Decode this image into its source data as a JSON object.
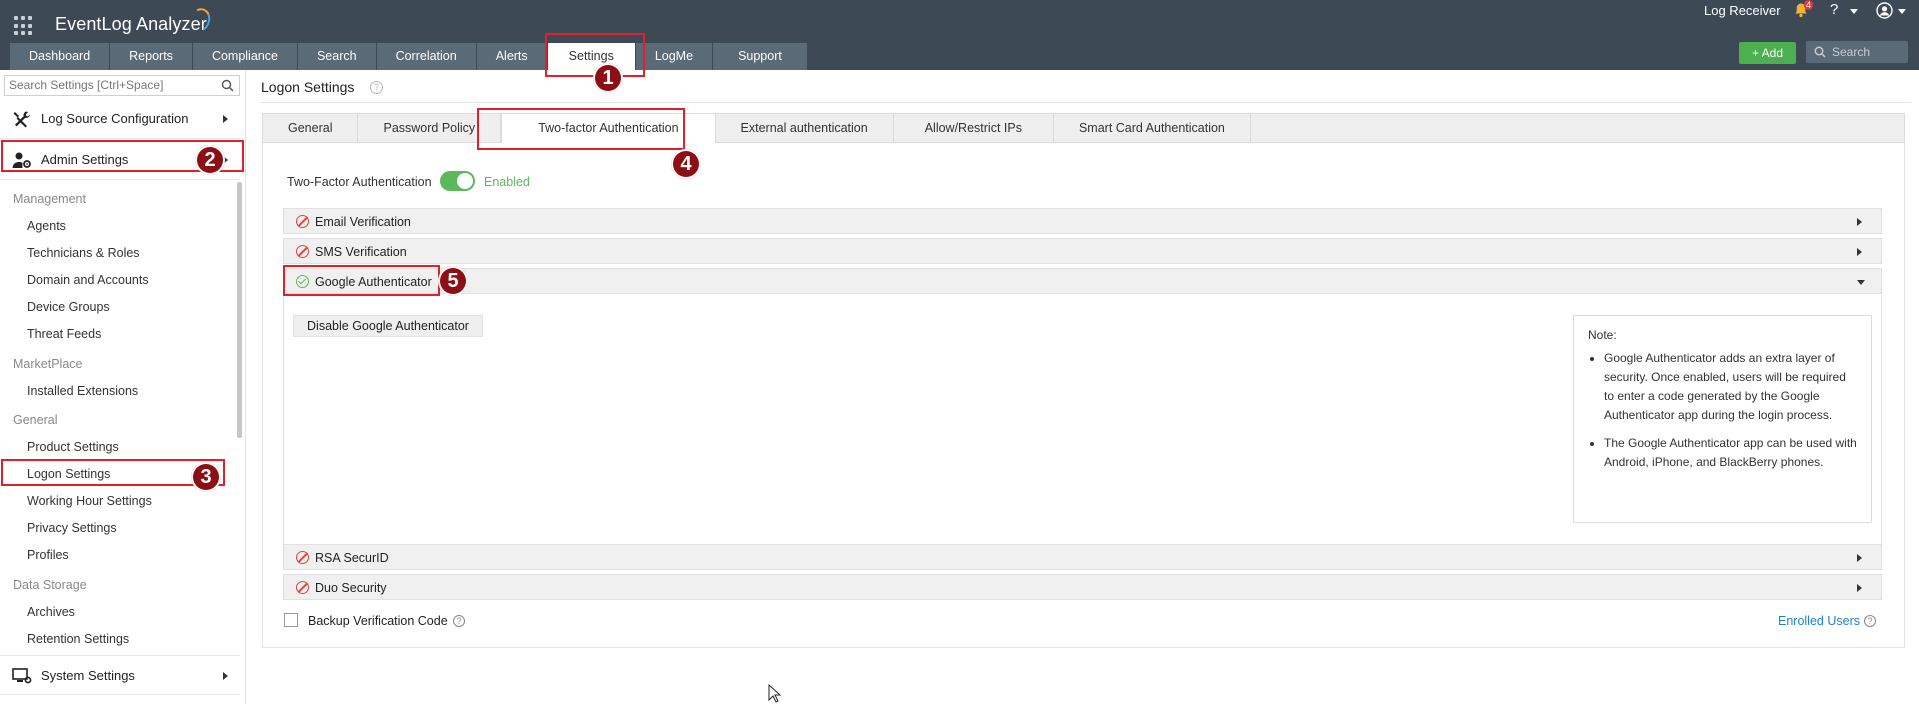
{
  "app": {
    "title": "EventLog Analyzer"
  },
  "topbar": {
    "log_receiver": "Log Receiver",
    "notification_count": "4",
    "help_label": "?",
    "add_label": "+ Add",
    "search_placeholder": "Search"
  },
  "nav": {
    "tabs": [
      "Dashboard",
      "Reports",
      "Compliance",
      "Search",
      "Correlation",
      "Alerts",
      "Settings",
      "LogMe",
      "Support"
    ],
    "active": "Settings"
  },
  "sidebar": {
    "search_placeholder": "Search Settings [Ctrl+Space]",
    "log_source": "Log Source Configuration",
    "admin": "Admin Settings",
    "system": "System Settings",
    "groups": {
      "management": "Management",
      "marketplace": "MarketPlace",
      "general": "General",
      "data_storage": "Data Storage"
    },
    "items": {
      "agents": "Agents",
      "technicians": "Technicians & Roles",
      "domain": "Domain and Accounts",
      "device_groups": "Device Groups",
      "threat_feeds": "Threat Feeds",
      "installed_ext": "Installed Extensions",
      "product_settings": "Product Settings",
      "logon_settings": "Logon Settings",
      "working_hour": "Working Hour Settings",
      "privacy": "Privacy Settings",
      "profiles": "Profiles",
      "archives": "Archives",
      "retention": "Retention Settings"
    }
  },
  "page": {
    "title": "Logon Settings",
    "tabs": [
      "General",
      "Password Policy",
      "Two-factor Authentication",
      "External authentication",
      "Allow/Restrict IPs",
      "Smart Card Authentication"
    ],
    "active_tab": "Two-factor Authentication"
  },
  "tfa": {
    "label": "Two-Factor Authentication",
    "status": "Enabled",
    "enabled": true
  },
  "methods": {
    "email": "Email Verification",
    "sms": "SMS Verification",
    "google": "Google Authenticator",
    "rsa": "RSA SecurID",
    "duo": "Duo Security"
  },
  "google_panel": {
    "disable_button": "Disable Google Authenticator",
    "note_title": "Note:",
    "note_1": "Google Authenticator adds an extra layer of security. Once enabled, users will be required to enter a code generated by the Google Authenticator app during the login process.",
    "note_2": "The Google Authenticator app can be used with Android, iPhone, and BlackBerry phones."
  },
  "footer": {
    "backup_label": "Backup Verification Code",
    "enrolled_users": "Enrolled Users"
  },
  "annotations": [
    "1",
    "2",
    "3",
    "4",
    "5"
  ],
  "colors": {
    "header": "#3d4a55",
    "nav_tab": "#5b6a77",
    "accent_green": "#5cb85c",
    "marker": "#8b0f14",
    "highlight": "#e0202a",
    "link": "#1f7fd6"
  }
}
